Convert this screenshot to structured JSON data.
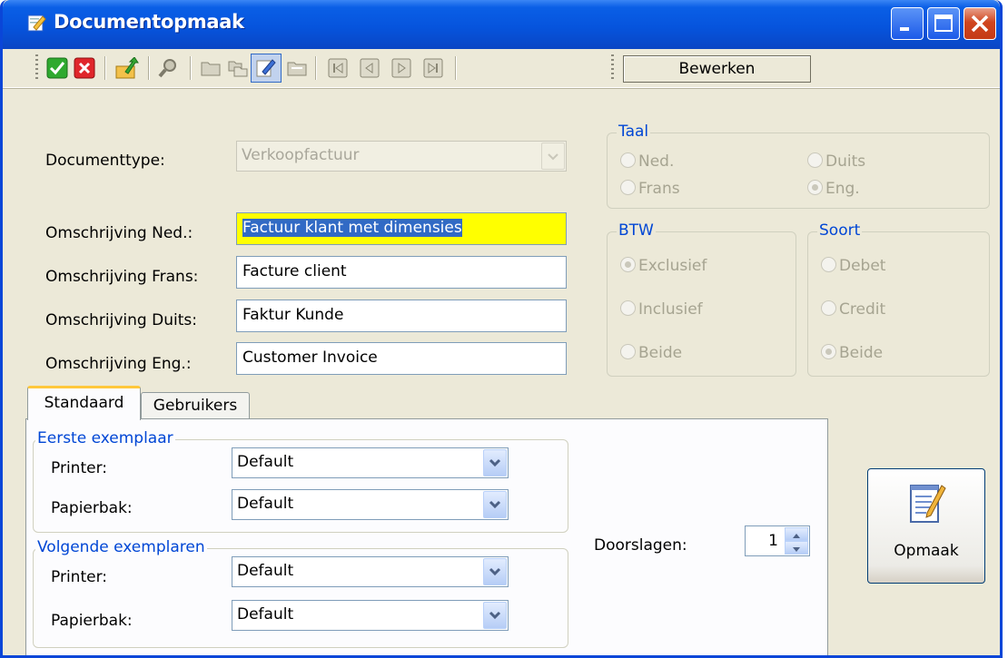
{
  "window": {
    "title": "Documentopmaak",
    "minimize_label": "_",
    "maximize_label": "□",
    "close_label": "X"
  },
  "toolbar": {
    "mode_label": "Bewerken",
    "icons": [
      "accept-icon",
      "cancel-icon",
      "export-icon",
      "search-icon",
      "folder-open-icon",
      "copy-icon",
      "edit-icon",
      "folder-icon",
      "first-record-icon",
      "previous-record-icon",
      "next-record-icon",
      "last-record-icon"
    ]
  },
  "form": {
    "documenttype_label": "Documenttype:",
    "documenttype_value": "Verkoopfactuur",
    "desc_ned_label": "Omschrijving Ned.:",
    "desc_ned_value": "Factuur klant met dimensies",
    "desc_frans_label": "Omschrijving Frans:",
    "desc_frans_value": "Facture client",
    "desc_duits_label": "Omschrijving Duits:",
    "desc_duits_value": "Faktur Kunde",
    "desc_eng_label": "Omschrijving Eng.:",
    "desc_eng_value": "Customer Invoice"
  },
  "taal": {
    "title": "Taal",
    "options": [
      "Ned.",
      "Duits",
      "Frans",
      "Eng."
    ],
    "selected": "Eng."
  },
  "btw": {
    "title": "BTW",
    "options": [
      "Exclusief",
      "Inclusief",
      "Beide"
    ],
    "selected": "Exclusief"
  },
  "soort": {
    "title": "Soort",
    "options": [
      "Debet",
      "Credit",
      "Beide"
    ],
    "selected": "Beide"
  },
  "tabs": {
    "standaard": "Standaard",
    "gebruikers": "Gebruikers"
  },
  "eerste": {
    "title": "Eerste exemplaar",
    "printer_label": "Printer:",
    "printer_value": "Default",
    "papierbak_label": "Papierbak:",
    "papierbak_value": "Default"
  },
  "volgende": {
    "title": "Volgende exemplaren",
    "printer_label": "Printer:",
    "printer_value": "Default",
    "papierbak_label": "Papierbak:",
    "papierbak_value": "Default"
  },
  "doorslagen": {
    "label": "Doorslagen:",
    "value": "1"
  },
  "opmaak_button": "Opmaak",
  "colors": {
    "titlebar": "#0654dd",
    "highlight": "#ffff00",
    "group_title": "#0046d5"
  }
}
